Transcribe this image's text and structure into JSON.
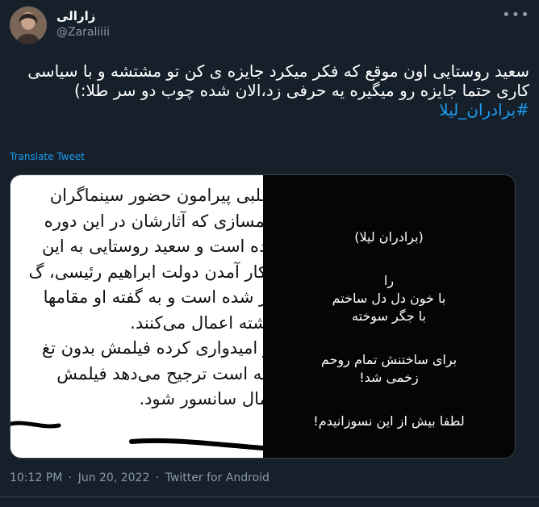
{
  "author": {
    "display_name": "زارالی",
    "handle": "@Zaraliiii"
  },
  "more_icon": "more-horizontal-icon",
  "tweet": {
    "text": "سعید روستایی اون موقع که فکر میکرد جایزه ی کن تو مشتشه و با سیاسی کاری حتما جایزه رو میگیره یه حرفی زد،الان شده چوب دو سر طلا:)",
    "hashtag": "#برادران_لیلا"
  },
  "translate_label": "Translate Tweet",
  "media": {
    "document_lines": [
      "مطلبی پیرامون حضور سینماگران",
      "فیلمسازی که آثارشان در این دوره",
      "کرده است و سعید روستایی به این",
      "ل کار آمدن دولت ابراهیم رئیسی، گ",
      "ختر شده است و به گفته او مقامها",
      "گذشته اعمال می‌کنند.",
      "راز امیدواری کرده فیلمش بدون تغ",
      "گفته است ترجیح می‌دهد فیلمش",
      "اعمال سانسور شود."
    ],
    "caption": {
      "title": "(برادران لیلا)",
      "line1": "را",
      "line2": "با خون دل دل ساختم",
      "line3": "با جگر سوخته",
      "line4": "برای ساختنش تمام روحم",
      "line5": "زخمی شد!",
      "line6": "لطفا بیش از این نسوزانیدم!"
    }
  },
  "footer": {
    "time": "10:12 PM",
    "date": "Jun 20, 2022",
    "source": "Twitter for Android",
    "separator": "·"
  }
}
